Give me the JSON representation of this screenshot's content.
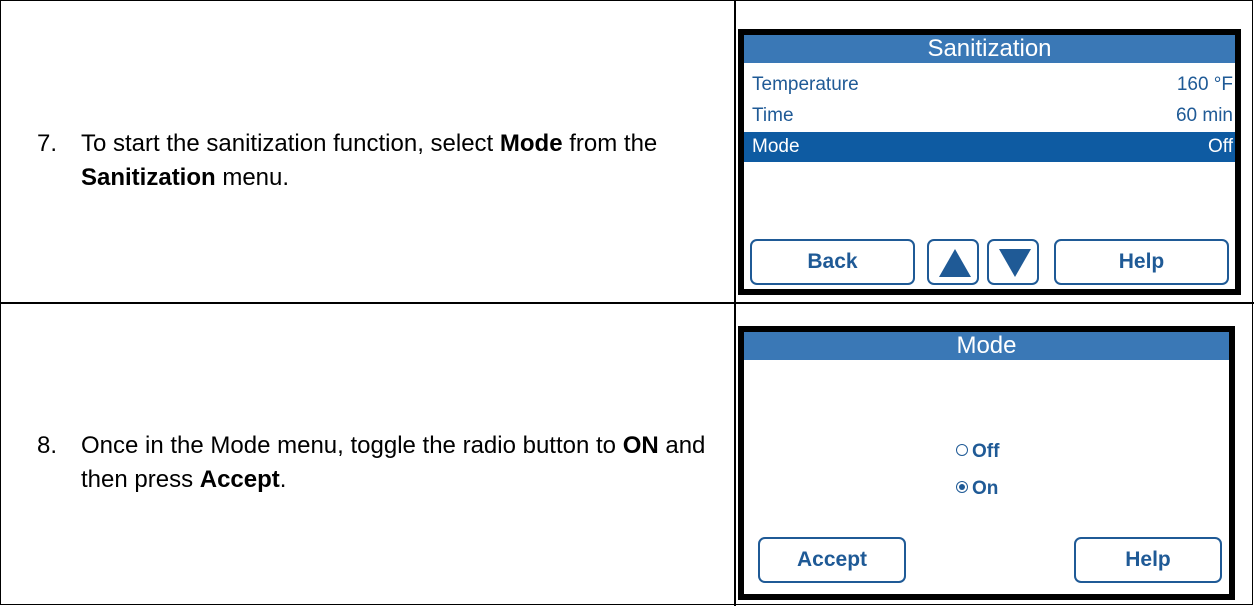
{
  "steps": [
    {
      "number": "7.",
      "pre": "To start the sanitization function, select ",
      "b1": "Mode",
      "mid": " from the ",
      "b2": "Sanitization",
      "post": " menu."
    },
    {
      "number": "8.",
      "pre": "Once in the Mode menu, toggle the radio button to ",
      "b1": "ON",
      "mid": " and then press ",
      "b2": "Accept",
      "post": "."
    }
  ],
  "screen1": {
    "title": "Sanitization",
    "rows": [
      {
        "label": "Temperature",
        "value": "160 °F",
        "selected": false
      },
      {
        "label": "Time",
        "value": "60 min",
        "selected": false
      },
      {
        "label": "Mode",
        "value": "Off",
        "selected": true
      }
    ],
    "buttons": {
      "back": "Back",
      "help": "Help"
    }
  },
  "screen2": {
    "title": "Mode",
    "options": [
      {
        "label": "Off",
        "checked": false
      },
      {
        "label": "On",
        "checked": true
      }
    ],
    "buttons": {
      "accept": "Accept",
      "help": "Help"
    }
  },
  "colors": {
    "title_bar": "#3a78b6",
    "selected_row": "#0e5ba2",
    "accent": "#1f5a96"
  },
  "icons": [
    "up-arrow-icon",
    "down-arrow-icon",
    "radio-off-icon",
    "radio-on-icon"
  ]
}
